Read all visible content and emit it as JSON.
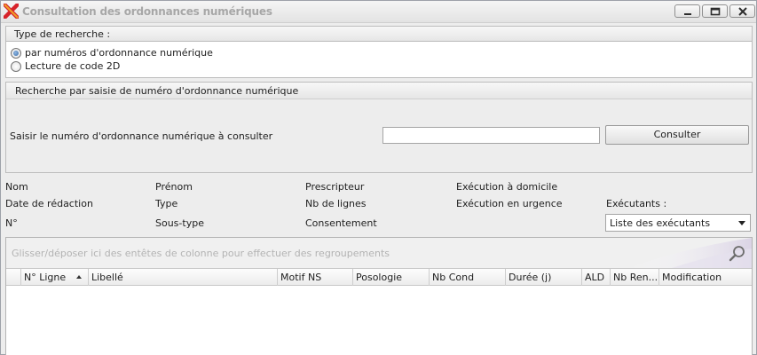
{
  "window": {
    "title": "Consultation des ordonnances numériques",
    "minimize_icon": "minimize-icon",
    "maximize_icon": "maximize-icon",
    "close_icon": "close-icon"
  },
  "search_type": {
    "title": "Type de recherche :",
    "options": [
      {
        "label": "par numéros d'ordonnance numérique",
        "selected": true
      },
      {
        "label": "Lecture de code 2D",
        "selected": false
      }
    ]
  },
  "search_by_number": {
    "title": "Recherche par saisie de numéro d'ordonnance numérique",
    "field_label": "Saisir le numéro d'ordonnance numérique à consulter",
    "field_value": "",
    "button_label": "Consulter"
  },
  "info": {
    "nom": "Nom",
    "prenom": "Prénom",
    "prescripteur": "Prescripteur",
    "execution_domicile": "Exécution à domicile",
    "date_redaction": "Date de rédaction",
    "type": "Type",
    "nb_lignes": "Nb de lignes",
    "execution_urgence": "Exécution en urgence",
    "executants": "Exécutants :",
    "numero": "N°",
    "sous_type": "Sous-type",
    "consentement": "Consentement",
    "executants_select": "Liste des exécutants"
  },
  "grid": {
    "group_panel_text": "Glisser/déposer ici des entêtes de colonne pour effectuer des regroupements",
    "columns": [
      "N° Ligne",
      "Libellé",
      "Motif NS",
      "Posologie",
      "Nb Cond",
      "Durée (j)",
      "ALD",
      "Nb Ren...",
      "Modification"
    ],
    "sorted_column": "N° Ligne"
  },
  "colors": {
    "accent": "#3a6ea9",
    "background": "#ededed",
    "disabled_text": "#a7a7a7"
  }
}
